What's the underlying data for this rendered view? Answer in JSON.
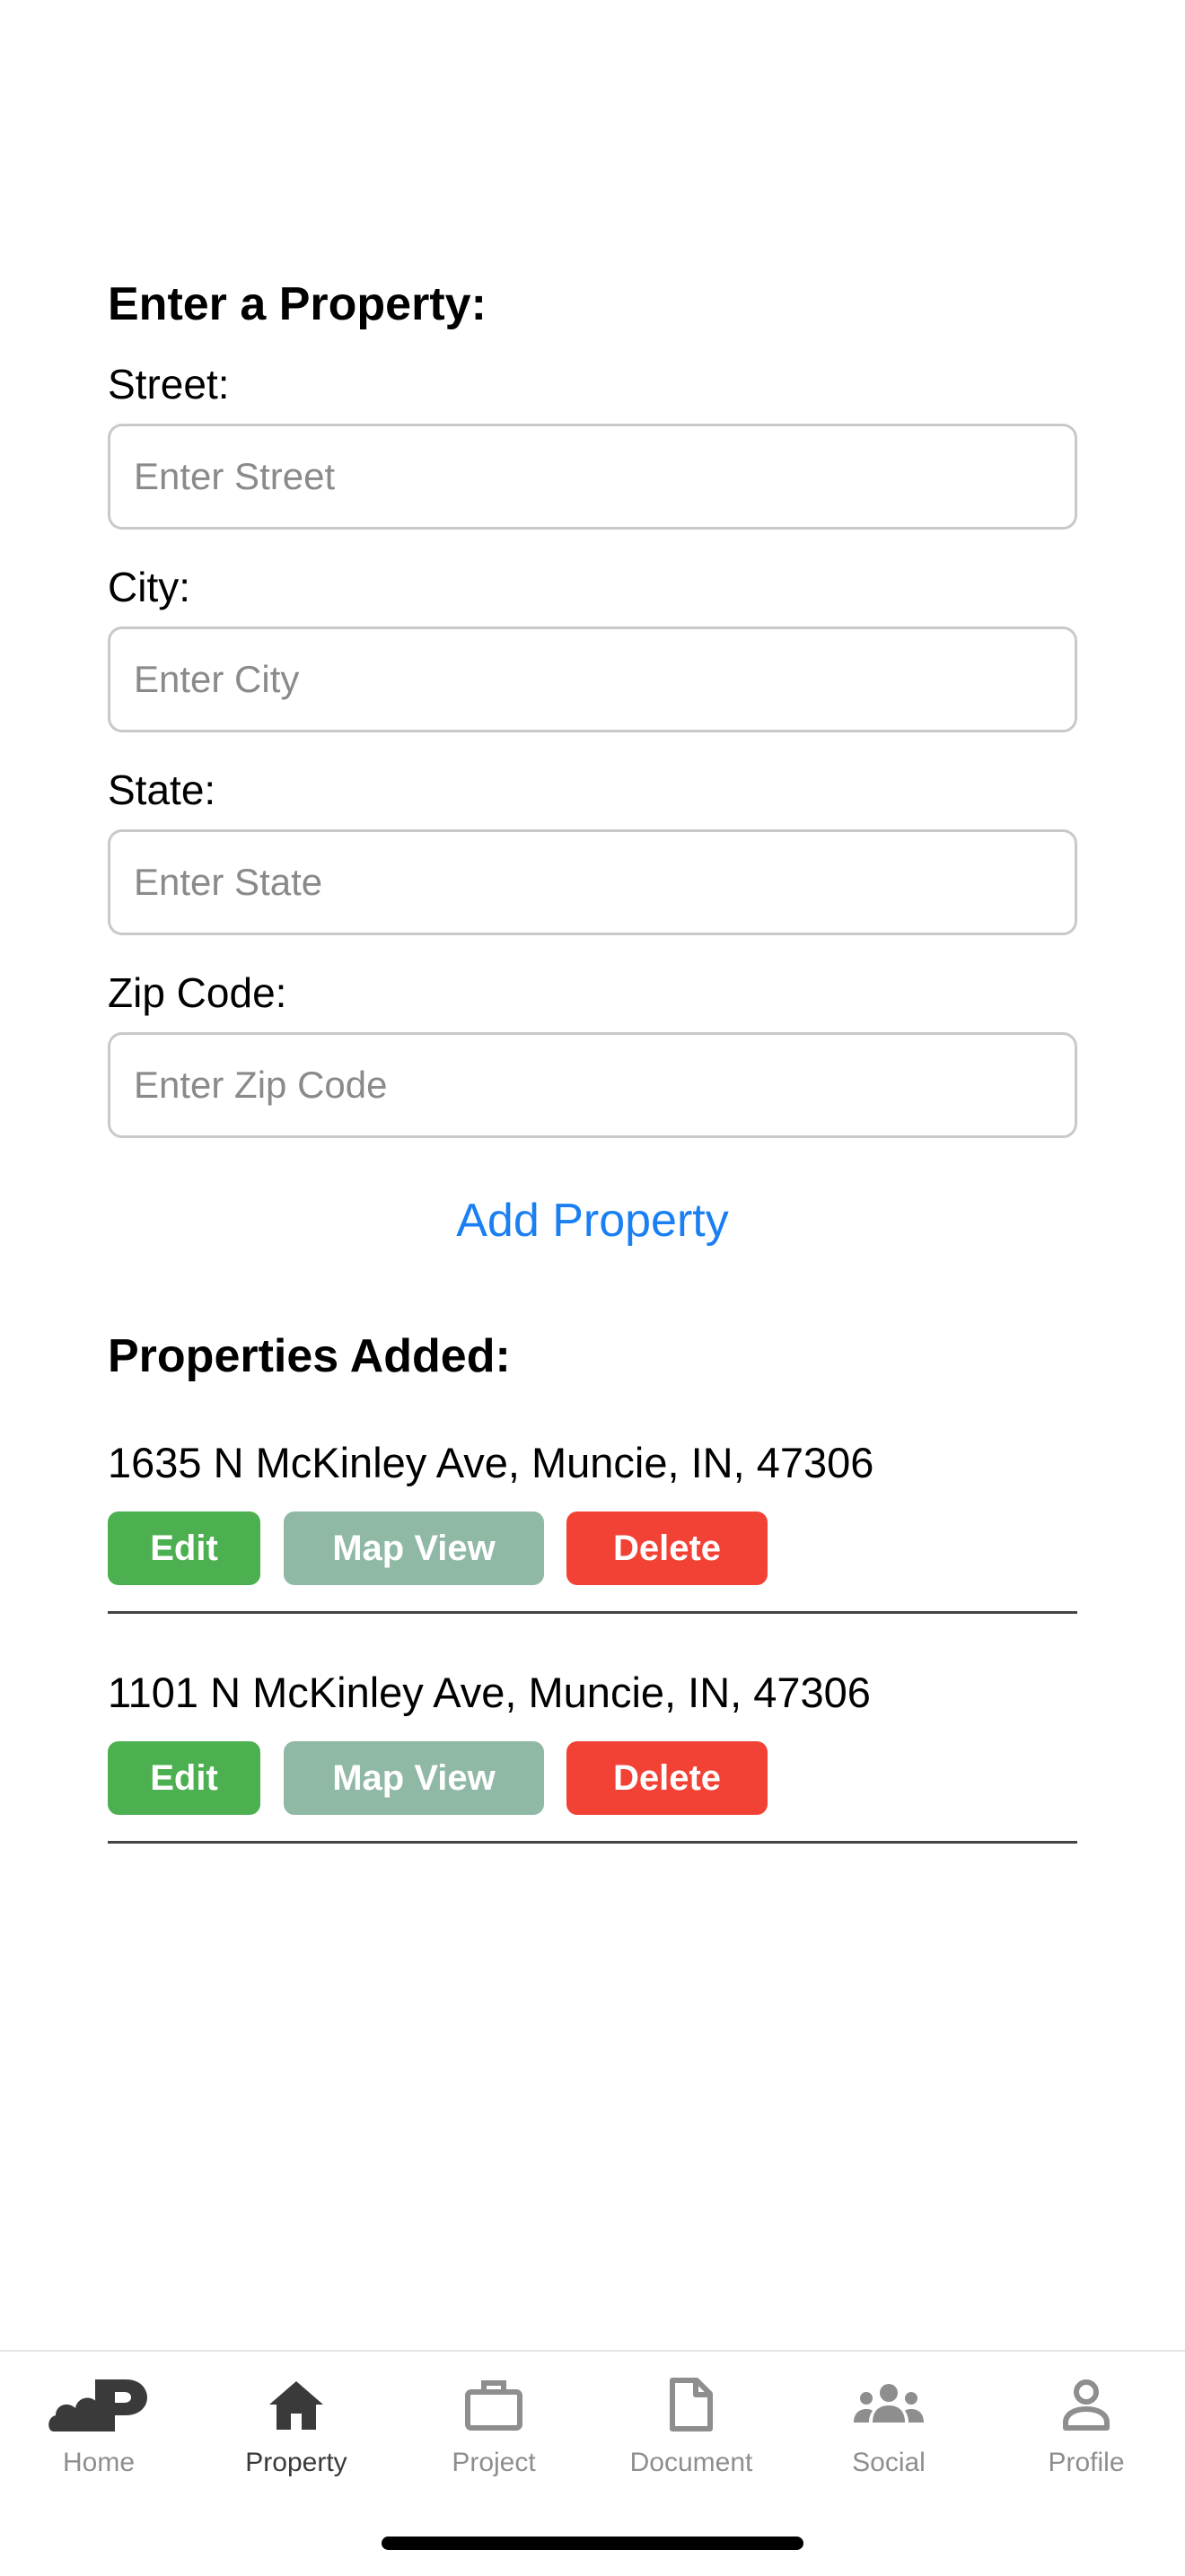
{
  "form": {
    "title": "Enter a Property:",
    "street": {
      "label": "Street:",
      "placeholder": "Enter Street",
      "value": ""
    },
    "city": {
      "label": "City:",
      "placeholder": "Enter City",
      "value": ""
    },
    "state": {
      "label": "State:",
      "placeholder": "Enter State",
      "value": ""
    },
    "zip": {
      "label": "Zip Code:",
      "placeholder": "Enter Zip Code",
      "value": ""
    },
    "add_button": "Add Property"
  },
  "properties": {
    "title": "Properties Added:",
    "items": [
      {
        "address": "1635 N McKinley Ave, Muncie, IN, 47306",
        "edit_label": "Edit",
        "map_label": "Map View",
        "delete_label": "Delete"
      },
      {
        "address": "1101 N McKinley Ave, Muncie, IN, 47306",
        "edit_label": "Edit",
        "map_label": "Map View",
        "delete_label": "Delete"
      }
    ]
  },
  "tabbar": {
    "active": "Property",
    "tabs": [
      {
        "label": "Home",
        "icon": "app-logo-icon"
      },
      {
        "label": "Property",
        "icon": "house-icon"
      },
      {
        "label": "Project",
        "icon": "briefcase-icon"
      },
      {
        "label": "Document",
        "icon": "document-icon"
      },
      {
        "label": "Social",
        "icon": "people-icon"
      },
      {
        "label": "Profile",
        "icon": "person-icon"
      }
    ]
  },
  "colors": {
    "link": "#1a7ff2",
    "edit": "#4cb050",
    "map_view": "#8fb8a5",
    "delete": "#f24236",
    "tab_active": "#3a3a3a",
    "tab_inactive": "#8e8e8e"
  }
}
